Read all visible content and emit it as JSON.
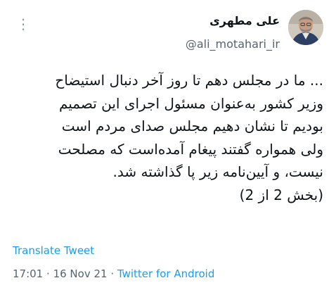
{
  "author": {
    "display_name": "علی مطهری",
    "handle": "@ali_motahari_ir"
  },
  "tweet": {
    "lines": [
      "... ما در مجلس دهم تا روز آخر دنبال استیضاح",
      "وزیر کشور به‌عنوان مسئول اجرای این تصمیم",
      "بودیم تا نشان دهیم مجلس صدای مردم است",
      "ولی همواره گفتند پیغام آمده‌است که مصلحت",
      "نیست، و آیین‌نامه زیر پا گذاشته شد.",
      "(بخش 2 از 2)"
    ]
  },
  "translate_label": "Translate Tweet",
  "meta": {
    "time": "17:01",
    "date": "16 Nov 21",
    "source": "Twitter for Android",
    "separator": "·"
  },
  "icons": {
    "more": "more-dots-icon"
  },
  "colors": {
    "link": "#1d9bf0",
    "secondary_text": "#536471",
    "primary_text": "#0f1419"
  }
}
